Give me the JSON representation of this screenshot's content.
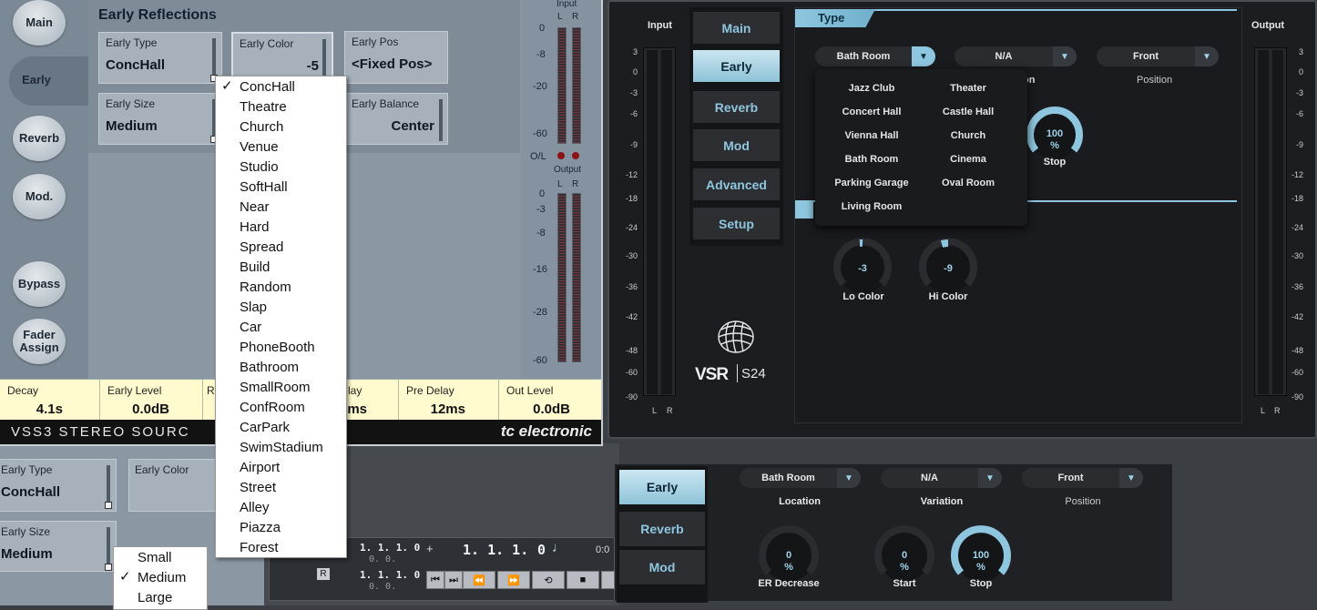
{
  "vss3": {
    "nav": {
      "main": "Main",
      "early": "Early",
      "reverb": "Reverb",
      "mod": "Mod.",
      "bypass": "Bypass",
      "fader_assign_l1": "Fader",
      "fader_assign_l2": "Assign"
    },
    "panel_title": "Early Reflections",
    "params": {
      "early_type": {
        "label": "Early Type",
        "value": "ConcHall"
      },
      "early_color": {
        "label": "Early Color",
        "value": "-5"
      },
      "early_pos": {
        "label": "Early Pos",
        "value": "<Fixed Pos>"
      },
      "early_size": {
        "label": "Early Size",
        "value": "Medium"
      },
      "early_balance": {
        "label": "Early Balance",
        "value": "Center"
      }
    },
    "meters": {
      "input_label": "Input",
      "output_label": "Output",
      "l": "L",
      "r": "R",
      "ol_label": "O/L",
      "input_scale": [
        "0",
        "-8",
        "-20",
        "-60"
      ],
      "output_scale": [
        "0",
        "-3",
        "-8",
        "-16",
        "-28",
        "-60"
      ]
    },
    "bottom": {
      "decay": {
        "label": "Decay",
        "value": "4.1s"
      },
      "early_level": {
        "label": "Early Level",
        "value": "0.0dB"
      },
      "r_partial": "R",
      "delay_partial": {
        "label": "lay",
        "value": "ms"
      },
      "pre_delay": {
        "label": "Pre Delay",
        "value": "12ms"
      },
      "out_level": {
        "label": "Out Level",
        "value": "0.0dB"
      }
    },
    "brand_left": "VSS3 STEREO SOURC",
    "brand_right": "tc electronic"
  },
  "early_type_menu": {
    "selected": "ConcHall",
    "items": [
      "ConcHall",
      "Theatre",
      "Church",
      "Venue",
      "Studio",
      "SoftHall",
      "Near",
      "Hard",
      "Spread",
      "Build",
      "Random",
      "Slap",
      "Car",
      "PhoneBooth",
      "Bathroom",
      "SmallRoom",
      "ConfRoom",
      "CarPark",
      "SwimStadium",
      "Airport",
      "Street",
      "Alley",
      "Piazza",
      "Forest"
    ],
    "check": "✓"
  },
  "vss3_lower": {
    "early_type": {
      "label": "Early Type",
      "value": "ConcHall"
    },
    "early_color": {
      "label": "Early Color"
    },
    "early_size": {
      "label": "Early Size",
      "value": "Medium"
    }
  },
  "size_menu": {
    "items": [
      "Small",
      "Medium",
      "Large"
    ],
    "selected": "Medium",
    "check": "✓"
  },
  "transport": {
    "pos1": "1. 1. 1.  0",
    "pos1b": "0.  0.",
    "pos2": "1. 1. 1.  0",
    "pos2b": "0.  0.",
    "main_pos": "1. 1. 1.",
    "main_tick": "0",
    "time_partial": "0:0",
    "r_label": "R",
    "plus": "+"
  },
  "vsr": {
    "input_label": "Input",
    "output_label": "Output",
    "l": "L",
    "r": "R",
    "scale": [
      "3",
      "0",
      "-3",
      "-6",
      "-9",
      "-12",
      "-18",
      "-24",
      "-30",
      "-36",
      "-42",
      "-48",
      "-60",
      "-90"
    ],
    "tabs": [
      "Main",
      "Early",
      "Reverb",
      "Mod",
      "Advanced",
      "Setup"
    ],
    "selected_tab": "Early",
    "section_type": "Type",
    "location_dd": "Bath Room",
    "variation_dd": "N/A",
    "position_dd": "Front",
    "position_label": "Position",
    "partial_label": "on",
    "stop": {
      "value": "100",
      "unit": "%",
      "label": "Stop"
    },
    "lo_color": {
      "value": "-3",
      "label": "Lo Color"
    },
    "hi_color": {
      "value": "-9",
      "label": "Hi Color"
    },
    "logo_text": "VSR",
    "logo_sub": "S24",
    "type_menu": [
      [
        "Jazz Club",
        "Theater"
      ],
      [
        "Concert Hall",
        "Castle Hall"
      ],
      [
        "Vienna Hall",
        "Church"
      ],
      [
        "Bath Room",
        "Cinema"
      ],
      [
        "Parking Garage",
        "Oval Room"
      ],
      [
        "Living Room",
        ""
      ]
    ],
    "colors": {
      "accent": "#8ec6df",
      "bg": "#1c1d20"
    }
  },
  "vsr_lower": {
    "tabs": [
      "Early",
      "Reverb",
      "Mod"
    ],
    "selected_tab": "Early",
    "location_dd": "Bath Room",
    "variation_dd": "N/A",
    "position_dd": "Front",
    "location_label": "Location",
    "variation_label": "Variation",
    "position_label": "Position",
    "er_decrease": {
      "value": "0",
      "unit": "%",
      "label": "ER Decrease"
    },
    "start": {
      "value": "0",
      "unit": "%",
      "label": "Start"
    },
    "stop": {
      "value": "100",
      "unit": "%",
      "label": "Stop"
    }
  }
}
